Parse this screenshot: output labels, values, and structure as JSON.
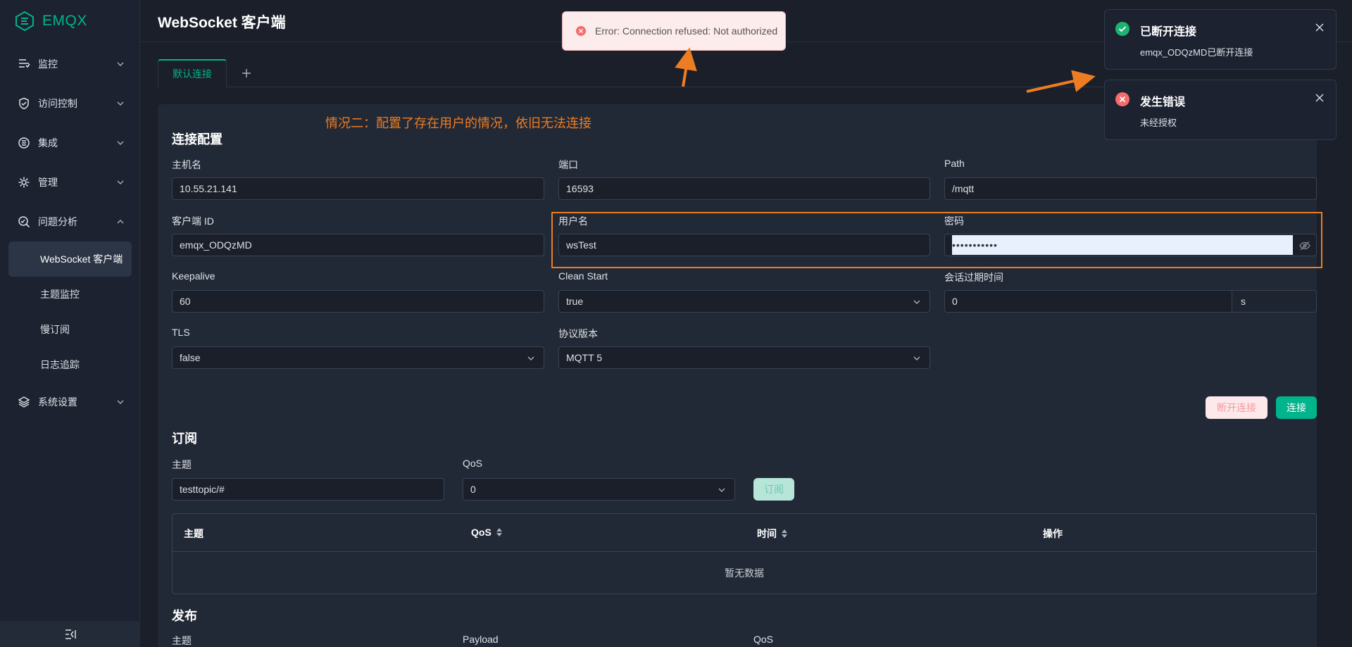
{
  "app": {
    "logo_text": "EMQX"
  },
  "sidebar": {
    "items": [
      {
        "label": "监控",
        "icon": "monitor-icon"
      },
      {
        "label": "访问控制",
        "icon": "shield-icon"
      },
      {
        "label": "集成",
        "icon": "integration-icon"
      },
      {
        "label": "管理",
        "icon": "gear-icon"
      },
      {
        "label": "问题分析",
        "icon": "diagnose-icon"
      },
      {
        "label": "系统设置",
        "icon": "settings-icon"
      }
    ],
    "sub_items": [
      {
        "label": "WebSocket 客户端",
        "active": true
      },
      {
        "label": "主题监控"
      },
      {
        "label": "慢订阅"
      },
      {
        "label": "日志追踪"
      }
    ]
  },
  "header": {
    "title": "WebSocket 客户端"
  },
  "tabs": {
    "active_label": "默认连接",
    "add_label": "+"
  },
  "annotation": "情况二：配置了存在用户的情况，依旧无法连接",
  "connection": {
    "section_title": "连接配置",
    "host_label": "主机名",
    "host_value": "10.55.21.141",
    "port_label": "端口",
    "port_value": "16593",
    "path_label": "Path",
    "path_value": "/mqtt",
    "clientid_label": "客户端 ID",
    "clientid_value": "emqx_ODQzMD",
    "username_label": "用户名",
    "username_value": "wsTest",
    "password_label": "密码",
    "password_value": "•••••••••••",
    "keepalive_label": "Keepalive",
    "keepalive_value": "60",
    "cleanstart_label": "Clean Start",
    "cleanstart_value": "true",
    "session_label": "会话过期时间",
    "session_value": "0",
    "session_unit": "s",
    "tls_label": "TLS",
    "tls_value": "false",
    "protocol_label": "协议版本",
    "protocol_value": "MQTT 5",
    "disconnect_label": "断开连接",
    "connect_label": "连接"
  },
  "subscribe": {
    "section_title": "订阅",
    "topic_label": "主题",
    "topic_value": "testtopic/#",
    "qos_label": "QoS",
    "qos_value": "0",
    "button_label": "订阅",
    "table": {
      "headers": [
        "主题",
        "QoS",
        "时间",
        "操作"
      ],
      "empty_text": "暂无数据"
    }
  },
  "publish": {
    "section_title": "发布",
    "topic_label": "主题",
    "payload_label": "Payload",
    "qos_label": "QoS"
  },
  "error_message": "Error: Connection refused: Not authorized",
  "notifications": [
    {
      "title": "已断开连接",
      "body": "emqx_ODQzMD已断开连接",
      "type": "success"
    },
    {
      "title": "发生错误",
      "body": "未经授权",
      "type": "error"
    }
  ],
  "colors": {
    "accent": "#00b48c",
    "annotation": "#ed7d22",
    "error": "#f56c6c",
    "background": "#1a1f29"
  }
}
